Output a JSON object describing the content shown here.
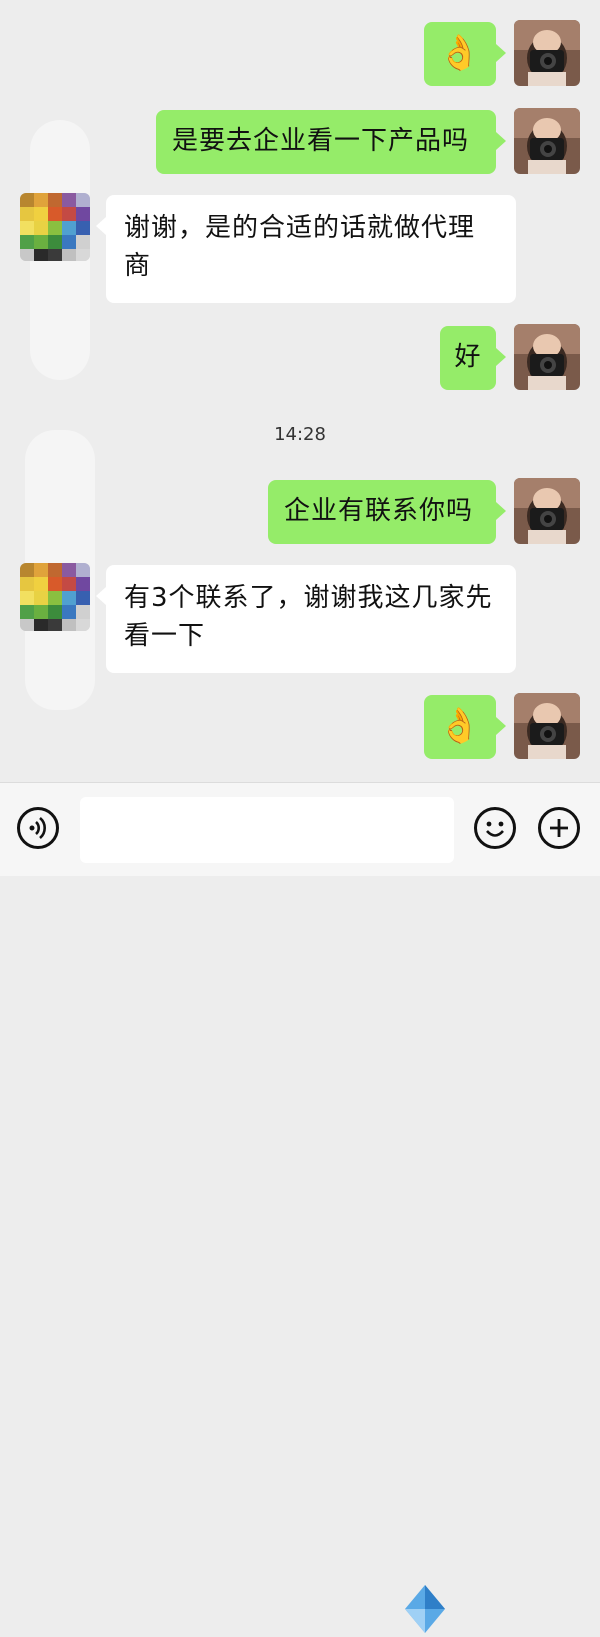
{
  "messages": [
    {
      "side": "me",
      "type": "emoji",
      "content": "👌"
    },
    {
      "side": "me",
      "type": "text",
      "content": "是要去企业看一下产品吗"
    },
    {
      "side": "other",
      "type": "text",
      "lines": [
        "谢谢，是的合适的话就做代理",
        "商"
      ]
    },
    {
      "side": "me",
      "type": "text",
      "content": "好"
    },
    {
      "side": "me",
      "type": "text",
      "content": "企业有联系你吗"
    },
    {
      "side": "other",
      "type": "text",
      "lines": [
        "有3个联系了，谢谢我这几家先",
        "看一下"
      ]
    },
    {
      "side": "me",
      "type": "emoji",
      "content": "👌"
    }
  ],
  "timestamp": "14:28",
  "input_bar": {
    "voice_icon": "voice-icon",
    "emoji_icon": "emoji-icon",
    "plus_icon": "plus-icon",
    "input_value": ""
  },
  "colors": {
    "background": "#ededed",
    "my_bubble": "#95ec69",
    "other_bubble": "#ffffff",
    "input_bar": "#f6f6f6"
  }
}
